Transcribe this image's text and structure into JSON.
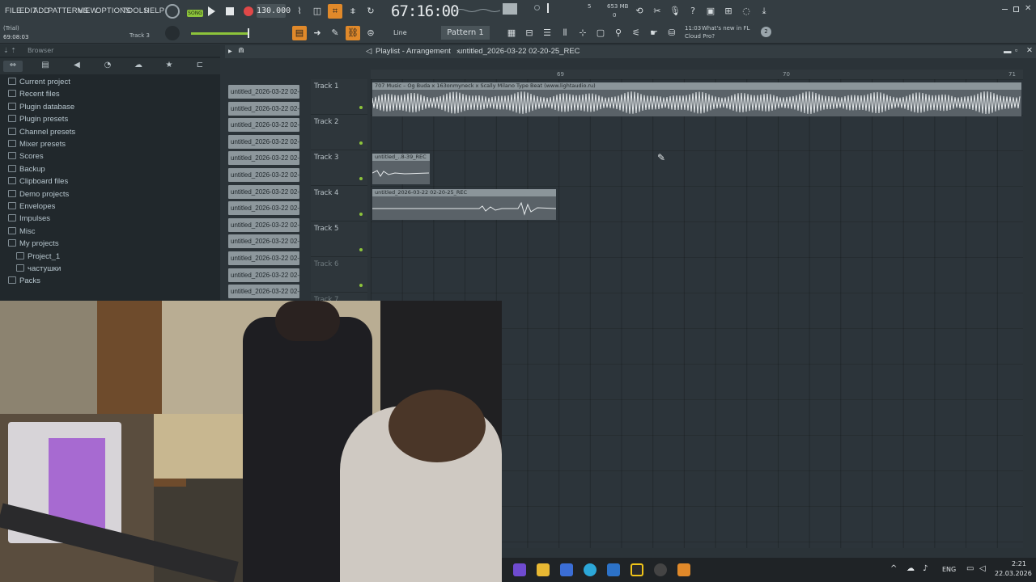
{
  "menu": [
    "FILE",
    "EDIT",
    "ADD",
    "PATTERNS",
    "VIEW",
    "OPTIONS",
    "TOOLS",
    "HELP"
  ],
  "status": {
    "trial": "(Trial)",
    "time": "69:08:03",
    "track": "Track 3"
  },
  "transport": {
    "song_label": "SONG",
    "tempo": "130.000",
    "time_display": "67:16:00",
    "memory": "653 MB",
    "cpu_top": "5",
    "cpu_bottom": "0"
  },
  "toolbar2": {
    "snap": "Line",
    "pattern": "Pattern 1",
    "news_time": "11:03",
    "news_line1": "What's new in FL",
    "news_line2": "Cloud Pro?",
    "news_badge": "2"
  },
  "browser": {
    "title": "Browser",
    "items": [
      {
        "label": "Current project",
        "icon": "project-icon"
      },
      {
        "label": "Recent files",
        "icon": "folder-icon"
      },
      {
        "label": "Plugin database",
        "icon": "plugin-icon"
      },
      {
        "label": "Plugin presets",
        "icon": "plugin-icon"
      },
      {
        "label": "Channel presets",
        "icon": "plugin-icon"
      },
      {
        "label": "Mixer presets",
        "icon": "plugin-icon"
      },
      {
        "label": "Scores",
        "icon": "note-icon"
      },
      {
        "label": "Backup",
        "icon": "folder-icon"
      },
      {
        "label": "Clipboard files",
        "icon": "folder-icon"
      },
      {
        "label": "Demo projects",
        "icon": "folder-icon"
      },
      {
        "label": "Envelopes",
        "icon": "folder-icon"
      },
      {
        "label": "Impulses",
        "icon": "folder-icon"
      },
      {
        "label": "Misc",
        "icon": "folder-icon"
      },
      {
        "label": "My projects",
        "icon": "folder-open-icon"
      },
      {
        "label": "Project_1",
        "icon": "folder-icon"
      },
      {
        "label": "частушки",
        "icon": "folder-icon"
      },
      {
        "label": "Packs",
        "icon": "folder-icon"
      }
    ]
  },
  "picker": {
    "clips": [
      "untitled_2026-03-22 02-…",
      "untitled_2026-03-22 02-…",
      "untitled_2026-03-22 02-…",
      "untitled_2026-03-22 02-…",
      "untitled_2026-03-22 02-…",
      "untitled_2026-03-22 02-…",
      "untitled_2026-03-22 02-…",
      "untitled_2026-03-22 02-…",
      "untitled_2026-03-22 02-…",
      "untitled_2026-03-22 02-…",
      "untitled_2026-03-22 02-…",
      "untitled_2026-03-22 02-…",
      "untitled_2026-03-22 02-…"
    ]
  },
  "playlist": {
    "title": "Playlist - Arrangement",
    "project": "untitled_2026-03-22 02-20-25_REC",
    "ruler": [
      "69",
      "70",
      "71"
    ],
    "tracks": [
      "Track 1",
      "Track 2",
      "Track 3",
      "Track 4",
      "Track 5",
      "Track 6",
      "Track 7"
    ],
    "clips": [
      {
        "track": 1,
        "title": "707 Music – Og Buda x 163onmyneck x Scally Milano Type Beat (www.lightaudio.ru)"
      },
      {
        "track": 3,
        "title": "untitled_..8-39_REC"
      },
      {
        "track": 4,
        "title": "untitled_2026-03-22 02-20-25_REC"
      }
    ]
  },
  "taskbar": {
    "lang": "ENG",
    "time": "2:21",
    "date": "22.03.2026"
  },
  "colors": {
    "accent": "#e0892a",
    "clip": "#5a6268",
    "panel": "#343d42"
  }
}
